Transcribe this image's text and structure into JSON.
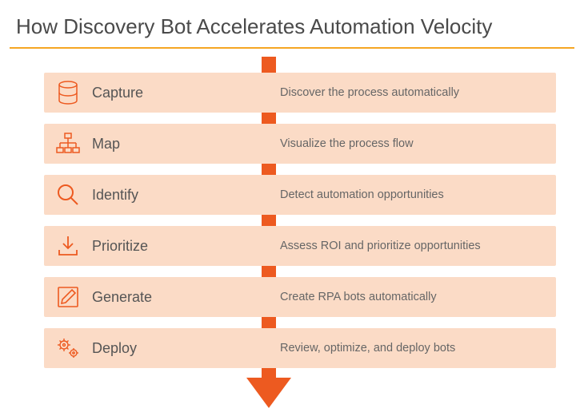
{
  "title": "How Discovery Bot Accelerates Automation Velocity",
  "steps": [
    {
      "icon": "database-icon",
      "label": "Capture",
      "desc": "Discover the process automatically"
    },
    {
      "icon": "flowchart-icon",
      "label": "Map",
      "desc": "Visualize the process flow"
    },
    {
      "icon": "magnifier-icon",
      "label": "Identify",
      "desc": "Detect automation opportunities"
    },
    {
      "icon": "download-icon",
      "label": "Prioritize",
      "desc": "Assess ROI and prioritize opportunities"
    },
    {
      "icon": "pencil-icon",
      "label": "Generate",
      "desc": "Create RPA bots automatically"
    },
    {
      "icon": "gears-icon",
      "label": "Deploy",
      "desc": "Review, optimize, and deploy bots"
    }
  ],
  "colors": {
    "accent": "#ed5a20",
    "row_bg": "#fbdbc6",
    "underline": "#f5a623"
  }
}
